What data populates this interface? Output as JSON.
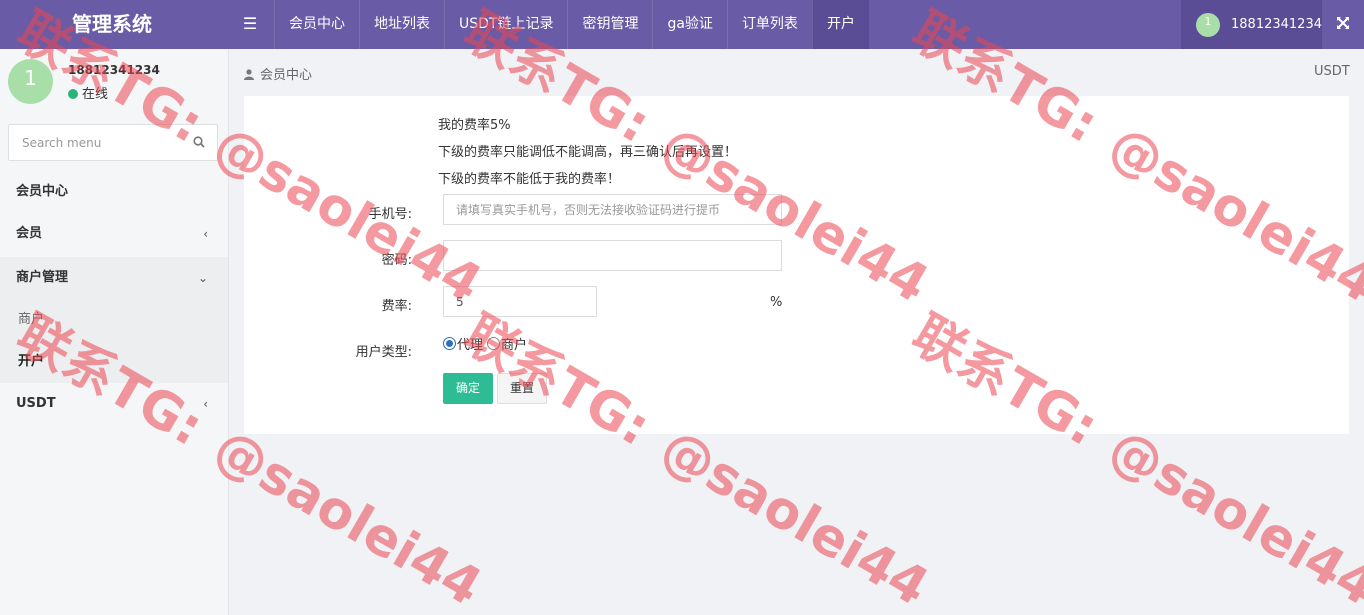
{
  "app": {
    "title": "管理系统"
  },
  "topnav": {
    "items": [
      {
        "label": "会员中心",
        "active": false
      },
      {
        "label": "地址列表",
        "active": false
      },
      {
        "label": "USDT链上记录",
        "active": false
      },
      {
        "label": "密钥管理",
        "active": false
      },
      {
        "label": "ga验证",
        "active": false
      },
      {
        "label": "订单列表",
        "active": false
      },
      {
        "label": "开户",
        "active": true
      }
    ],
    "user": {
      "avatar": "1",
      "name": "18812341234"
    }
  },
  "sidebar": {
    "profile": {
      "avatar": "1",
      "name": "18812341234",
      "status": "在线"
    },
    "search": {
      "placeholder": "Search menu"
    },
    "items": [
      {
        "label": "会员中心"
      },
      {
        "label": "会员",
        "arrow": "‹"
      },
      {
        "label": "商户管理",
        "arrow": "⌄",
        "expanded": true,
        "children": [
          {
            "label": "商户"
          },
          {
            "label": "开户",
            "active": true
          }
        ]
      },
      {
        "label": "USDT",
        "arrow": "‹"
      }
    ]
  },
  "breadcrumb": {
    "current": "会员中心",
    "right": "USDT"
  },
  "form": {
    "info": [
      "我的费率5%",
      "下级的费率只能调低不能调高，再三确认后再设置！",
      "下级的费率不能低于我的费率！"
    ],
    "phone": {
      "label": "手机号:",
      "placeholder": "请填写真实手机号，否则无法接收验证码进行提币",
      "value": ""
    },
    "password": {
      "label": "密码:",
      "value": ""
    },
    "rate": {
      "label": "费率:",
      "value": "5",
      "unit": "%"
    },
    "user_type": {
      "label": "用户类型:",
      "options": [
        "代理",
        "商户"
      ],
      "selected": "代理"
    },
    "submit_label": "确定",
    "reset_label": "重置"
  },
  "watermark": {
    "line1": "联系TG:",
    "line2": "@saolei44"
  }
}
